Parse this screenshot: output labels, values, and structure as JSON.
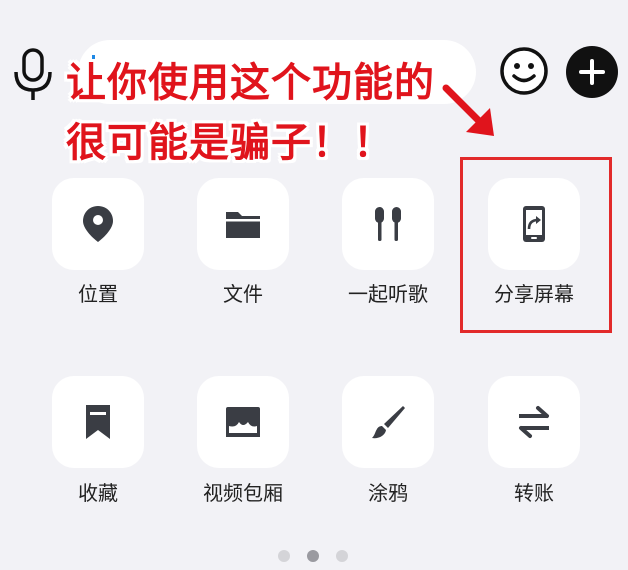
{
  "warning": {
    "line1": "让你使用这个功能的",
    "line2": "很可能是骗子！！"
  },
  "colors": {
    "warning_text": "#e0141c",
    "highlight_border": "#e22a2a",
    "caret": "#1e88e5"
  },
  "features": [
    {
      "label": "位置",
      "icon": "location-pin-icon"
    },
    {
      "label": "文件",
      "icon": "folder-icon"
    },
    {
      "label": "一起听歌",
      "icon": "earphones-icon"
    },
    {
      "label": "分享屏幕",
      "icon": "share-screen-icon"
    },
    {
      "label": "收藏",
      "icon": "bookmark-icon"
    },
    {
      "label": "视频包厢",
      "icon": "video-room-icon"
    },
    {
      "label": "涂鸦",
      "icon": "brush-icon"
    },
    {
      "label": "转账",
      "icon": "transfer-arrows-icon"
    }
  ],
  "pagination": {
    "total": 3,
    "active": 2
  }
}
